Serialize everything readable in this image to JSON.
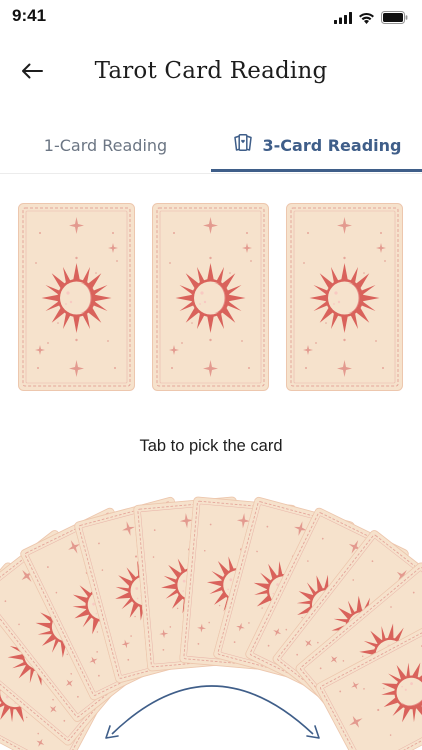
{
  "status_bar": {
    "time": "9:41"
  },
  "header": {
    "title": "Tarot Card Reading",
    "back_icon": "arrow-left-icon"
  },
  "tabs": [
    {
      "label": "1-Card Reading",
      "active": false
    },
    {
      "label": "3-Card Reading",
      "active": true,
      "icon": "cards-icon"
    }
  ],
  "hint": "Tab to pick the card",
  "colors": {
    "accent": "#3f5e89",
    "card_bg": "#f6e2cc",
    "card_line": "#e2a296",
    "sun": "#d9625b"
  },
  "deck": {
    "card_count": 12,
    "gesture_icon": "swipe-arc-icon"
  }
}
